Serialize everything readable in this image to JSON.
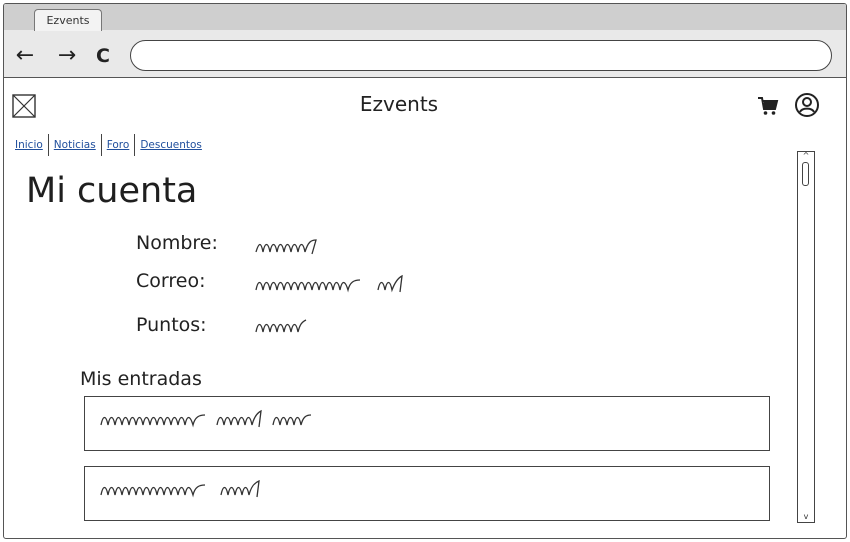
{
  "browser": {
    "tab_title": "Ezvents",
    "back_icon": "arrow-left-icon",
    "forward_icon": "arrow-right-icon",
    "reload_icon": "reload-icon",
    "back_glyph": "←",
    "forward_glyph": "→",
    "reload_glyph": "C",
    "url": ""
  },
  "header": {
    "logo_icon": "image-placeholder-icon",
    "title": "Ezvents",
    "cart_icon": "cart-icon",
    "user_icon": "user-icon"
  },
  "nav": {
    "items": [
      {
        "label": "Inicio"
      },
      {
        "label": "Noticias"
      },
      {
        "label": "Foro"
      },
      {
        "label": "Descuentos"
      }
    ]
  },
  "account": {
    "heading": "Mi cuenta",
    "fields": [
      {
        "label": "Nombre:",
        "value_placeholder": "scribble"
      },
      {
        "label": "Correo:",
        "value_placeholder": "scribble"
      },
      {
        "label": "Puntos:",
        "value_placeholder": "scribble"
      }
    ]
  },
  "tickets": {
    "heading": "Mis entradas",
    "items": [
      {
        "text_placeholder": "scribble"
      },
      {
        "text_placeholder": "scribble"
      }
    ]
  },
  "scrollbar": {
    "up_glyph": "^",
    "down_glyph": "v"
  }
}
